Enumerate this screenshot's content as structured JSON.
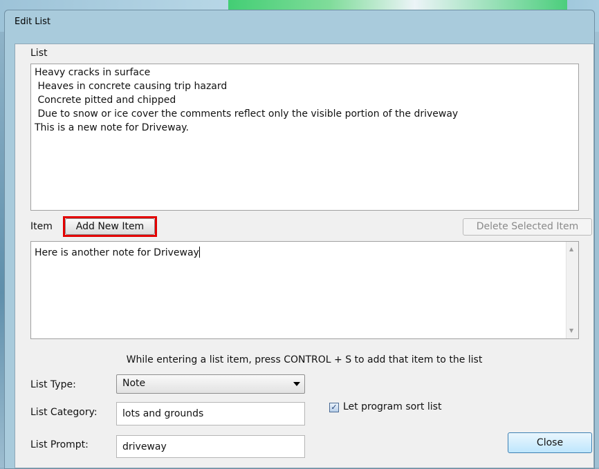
{
  "dialog": {
    "title": "Edit List"
  },
  "list": {
    "label": "List",
    "items": [
      "Heavy cracks in surface",
      " Heaves in concrete causing trip hazard",
      " Concrete pitted and chipped",
      " Due to snow or ice cover the comments reflect only the visible portion of the driveway",
      "This is a new note for Driveway."
    ]
  },
  "item": {
    "label": "Item",
    "add_button": "Add New Item",
    "delete_button": "Delete Selected Item",
    "value": "Here is another note for Driveway",
    "hint": "While entering a list item, press CONTROL + S to add that item to the list"
  },
  "list_type": {
    "label": "List Type:",
    "selected": "Note"
  },
  "list_category": {
    "label": "List Category:",
    "value": "lots and grounds"
  },
  "list_prompt": {
    "label": "List Prompt:",
    "value": "driveway"
  },
  "sort": {
    "label": "Let program sort list",
    "checked": true
  },
  "close_button": "Close",
  "colors": {
    "highlight": "#e30000",
    "dialog_frame": "#a9cbdc"
  }
}
